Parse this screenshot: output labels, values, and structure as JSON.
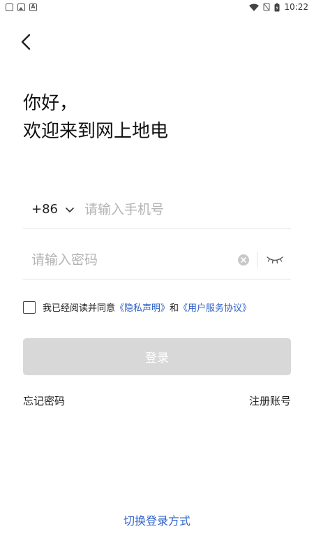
{
  "status_bar": {
    "time": "10:22"
  },
  "greeting": {
    "line1": "你好，",
    "line2": "欢迎来到网上地电"
  },
  "phone": {
    "country_code": "+86",
    "placeholder": "请输入手机号"
  },
  "password": {
    "placeholder": "请输入密码"
  },
  "agreement": {
    "prefix": "我已经阅读并同意",
    "privacy_link": "《隐私声明》",
    "and": "和",
    "service_link": "《用户服务协议》"
  },
  "login_button": "登录",
  "links": {
    "forgot": "忘记密码",
    "register": "注册账号"
  },
  "switch_login": "切换登录方式",
  "colors": {
    "link": "#2e62c9",
    "button_disabled": "#d8d8d8"
  }
}
